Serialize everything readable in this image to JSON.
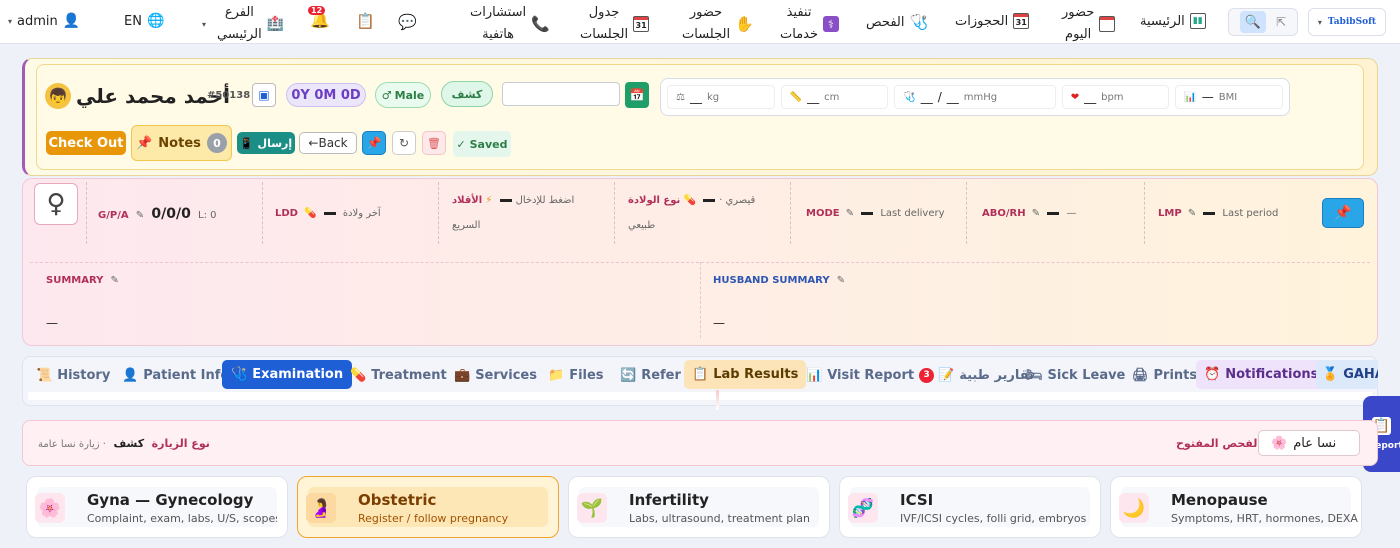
{
  "topbar": {
    "logo": "TabibSoft",
    "home": "الرئيسية",
    "today_line1": "حضور",
    "today_line2": "اليوم",
    "bookings": "الحجوزات",
    "cal_num": "31",
    "exam": "الفحص",
    "services_line1": "تنفيذ",
    "services_line2": "خدمات",
    "attendance_line1": "حضور",
    "attendance_line2": "الجلسات",
    "schedule_line1": "جدول",
    "schedule_line2": "الجلسات",
    "phone_line1": "استشارات",
    "phone_line2": "هاتفية",
    "notif_count": "12",
    "branch_line1": "الفرع",
    "branch_line2": "الرئيسي",
    "lang": "EN",
    "user": "admin"
  },
  "patient": {
    "name": "أحمد محمد علي",
    "id": "#50138",
    "age": "0Y 0M 0D",
    "gender": "Male",
    "visit_type": "كشف",
    "date_value": ""
  },
  "vitals": {
    "weight_unit": "kg",
    "height_unit": "cm",
    "bp_sep": "/",
    "bp_unit": "mmHg",
    "pulse_unit": "bpm",
    "bmi_value": "—",
    "bmi_label": "BMI",
    "blank": "__"
  },
  "actions": {
    "checkout": "Check Out",
    "notes": "Notes",
    "notes_count": "0",
    "send": "إرسال",
    "back": "←Back",
    "saved": "✓ Saved"
  },
  "ob": {
    "gpa_label": "G/P/A",
    "gpa_value": "0/0/0",
    "l_value": "L: 0",
    "ldd_label": "LDD",
    "ldd_desc": "آخر ولادة",
    "urgency_label": "الأقلاد",
    "urgency_desc1": "اضغط للإدخال",
    "urgency_desc2": "السريع",
    "delivery_label": "نوع الولادة",
    "delivery_desc1": "قيصري ·",
    "delivery_desc2": "طبيعي",
    "mode_label": "MODE",
    "mode_desc": "Last delivery",
    "abo_label": "ABO/RH",
    "abo_desc": "—",
    "lmp_label": "LMP",
    "lmp_desc": "Last period",
    "summary_label": "SUMMARY",
    "summary_value": "—",
    "husband_label": "HUSBAND SUMMARY",
    "husband_value": "—"
  },
  "tabs": [
    {
      "label": "History"
    },
    {
      "label": "Patient Info"
    },
    {
      "label": "Examination"
    },
    {
      "label": "Treatment"
    },
    {
      "label": "Services"
    },
    {
      "label": "Files"
    },
    {
      "label": "Refer"
    },
    {
      "label": "Lab Results"
    },
    {
      "label": "Visit Report",
      "badge": "3"
    },
    {
      "label": "تقارير طبية"
    },
    {
      "label": "Sick Leave"
    },
    {
      "label": "Prints"
    },
    {
      "label": "Notifications"
    },
    {
      "label": "GAHA"
    }
  ],
  "visit": {
    "type_label": "نوع الزيارة",
    "type_value": "كشف",
    "type_sub": "· زيارة نسا عامة",
    "open_exam_label": "الفحص المفتوح",
    "open_exam_value": "نسا عام"
  },
  "report_side": "Report",
  "cards": [
    {
      "title": "Gyna — Gynecology",
      "sub": "Complaint, exam, labs, U/S, scopes",
      "icon": "flower-icon"
    },
    {
      "title": "Obstetric",
      "sub": "Register / follow pregnancy",
      "icon": "pregnancy-icon"
    },
    {
      "title": "Infertility",
      "sub": "Labs, ultrasound, treatment plan",
      "icon": "sprout-icon"
    },
    {
      "title": "ICSI",
      "sub": "IVF/ICSI cycles, folli grid, embryos",
      "icon": "dna-icon"
    },
    {
      "title": "Menopause",
      "sub": "Symptoms, HRT, hormones, DEXA",
      "icon": "moon-icon"
    }
  ],
  "colors": {
    "accent_blue": "#1f5fd6",
    "orange": "#e8960a",
    "teal": "#1b8f86",
    "pink_label": "#b0305a"
  }
}
